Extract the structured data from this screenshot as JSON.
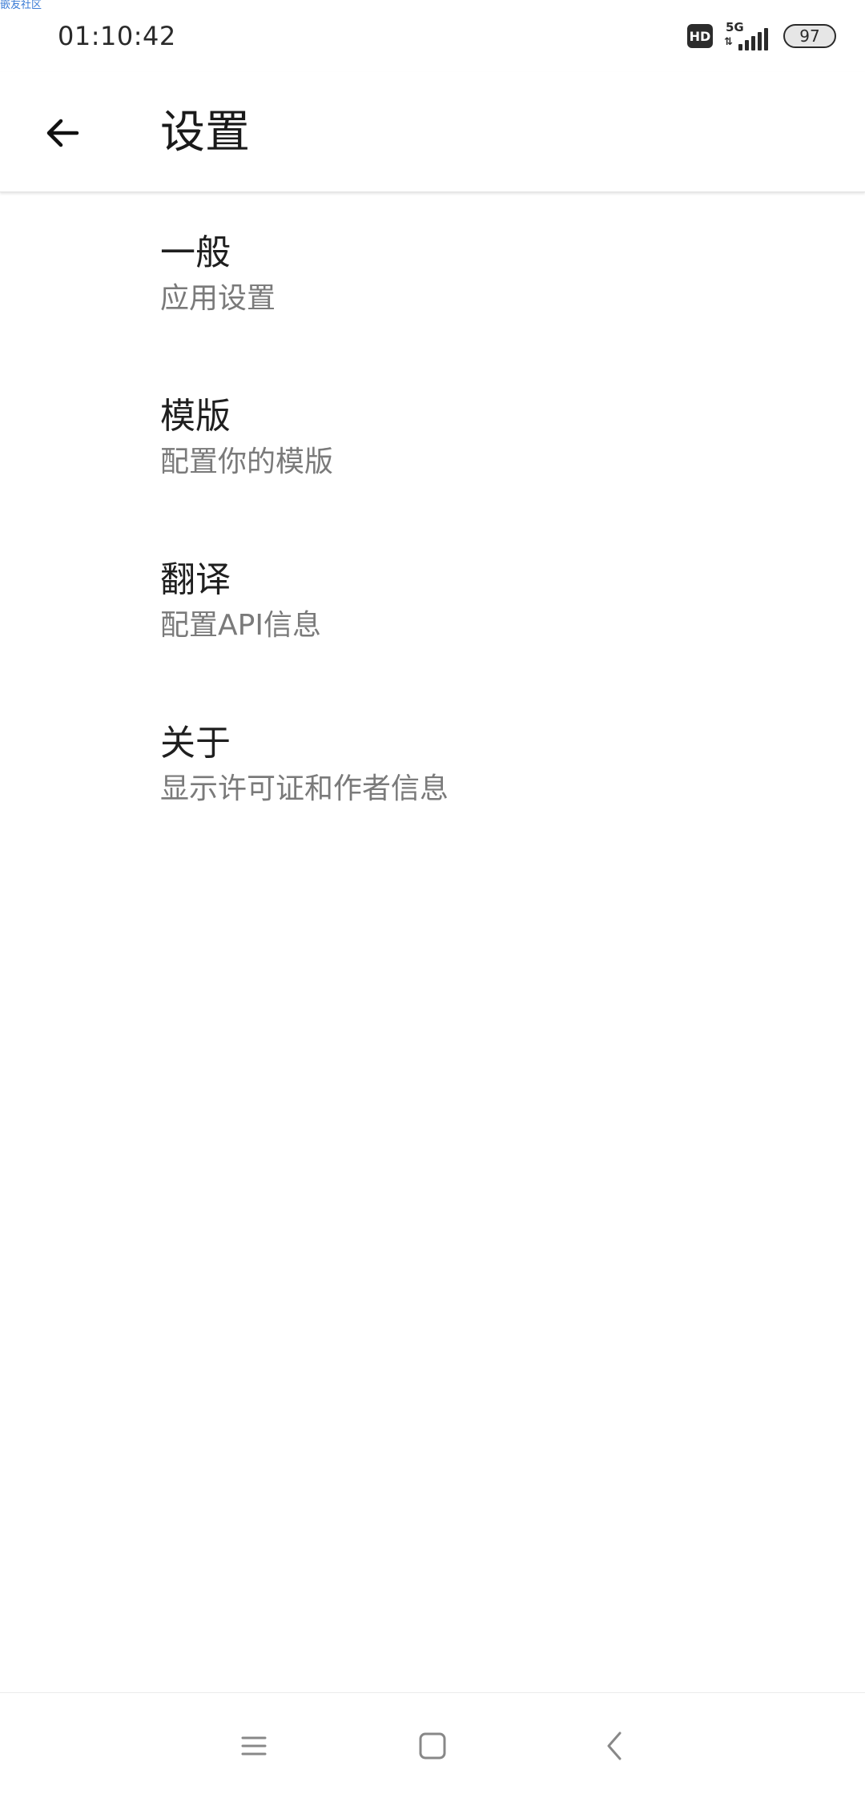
{
  "watermark": "嵌友社区",
  "status_bar": {
    "time": "01:10:42",
    "hd_label": "HD",
    "network_label": "5G",
    "data_arrows": "⇅",
    "battery_level": "97"
  },
  "app_bar": {
    "title": "设置",
    "back_icon": "arrow-left-icon"
  },
  "settings": {
    "items": [
      {
        "title": "一般",
        "summary": "应用设置"
      },
      {
        "title": "模版",
        "summary": "配置你的模版"
      },
      {
        "title": "翻译",
        "summary": "配置API信息"
      },
      {
        "title": "关于",
        "summary": "显示许可证和作者信息"
      }
    ]
  },
  "nav_bar": {
    "menu_icon": "menu-icon",
    "home_icon": "home-icon",
    "back_icon": "back-chevron-icon"
  },
  "colors": {
    "title_text": "#1f1f1f",
    "summary_text": "#7a7a7a",
    "watermark_text": "#3a7bd5",
    "background": "#ffffff"
  }
}
